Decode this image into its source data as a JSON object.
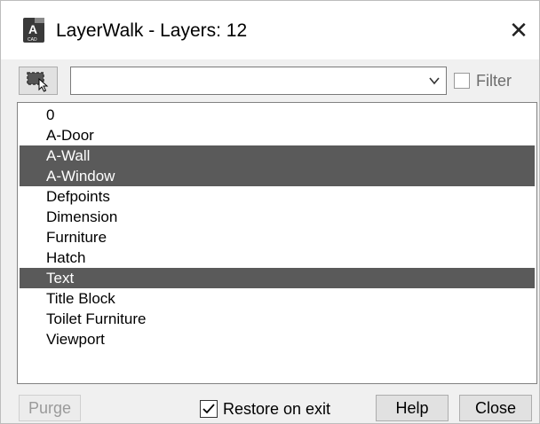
{
  "window": {
    "title": "LayerWalk - Layers: 12",
    "close_glyph": "✕",
    "app_icon": "autocad-app-icon",
    "app_icon_letter": "A",
    "app_icon_caption": "CAD"
  },
  "toolbar": {
    "select_objects_icon": "select-objects-icon",
    "filter_combo_value": "",
    "filter_label": "Filter",
    "filter_checked": false
  },
  "layers": [
    {
      "name": "0",
      "selected": false
    },
    {
      "name": "A-Door",
      "selected": false
    },
    {
      "name": "A-Wall",
      "selected": true
    },
    {
      "name": "A-Window",
      "selected": true
    },
    {
      "name": "Defpoints",
      "selected": false
    },
    {
      "name": "Dimension",
      "selected": false
    },
    {
      "name": "Furniture",
      "selected": false
    },
    {
      "name": "Hatch",
      "selected": false
    },
    {
      "name": "Text",
      "selected": true
    },
    {
      "name": "Title Block",
      "selected": false
    },
    {
      "name": "Toilet Furniture",
      "selected": false
    },
    {
      "name": "Viewport",
      "selected": false
    }
  ],
  "footer": {
    "purge_label": "Purge",
    "purge_enabled": false,
    "restore_label": "Restore on exit",
    "restore_checked": true,
    "help_label": "Help",
    "close_label": "Close"
  },
  "colors": {
    "selection": "#5a5a5a",
    "window_bg": "#f0f0f0"
  }
}
